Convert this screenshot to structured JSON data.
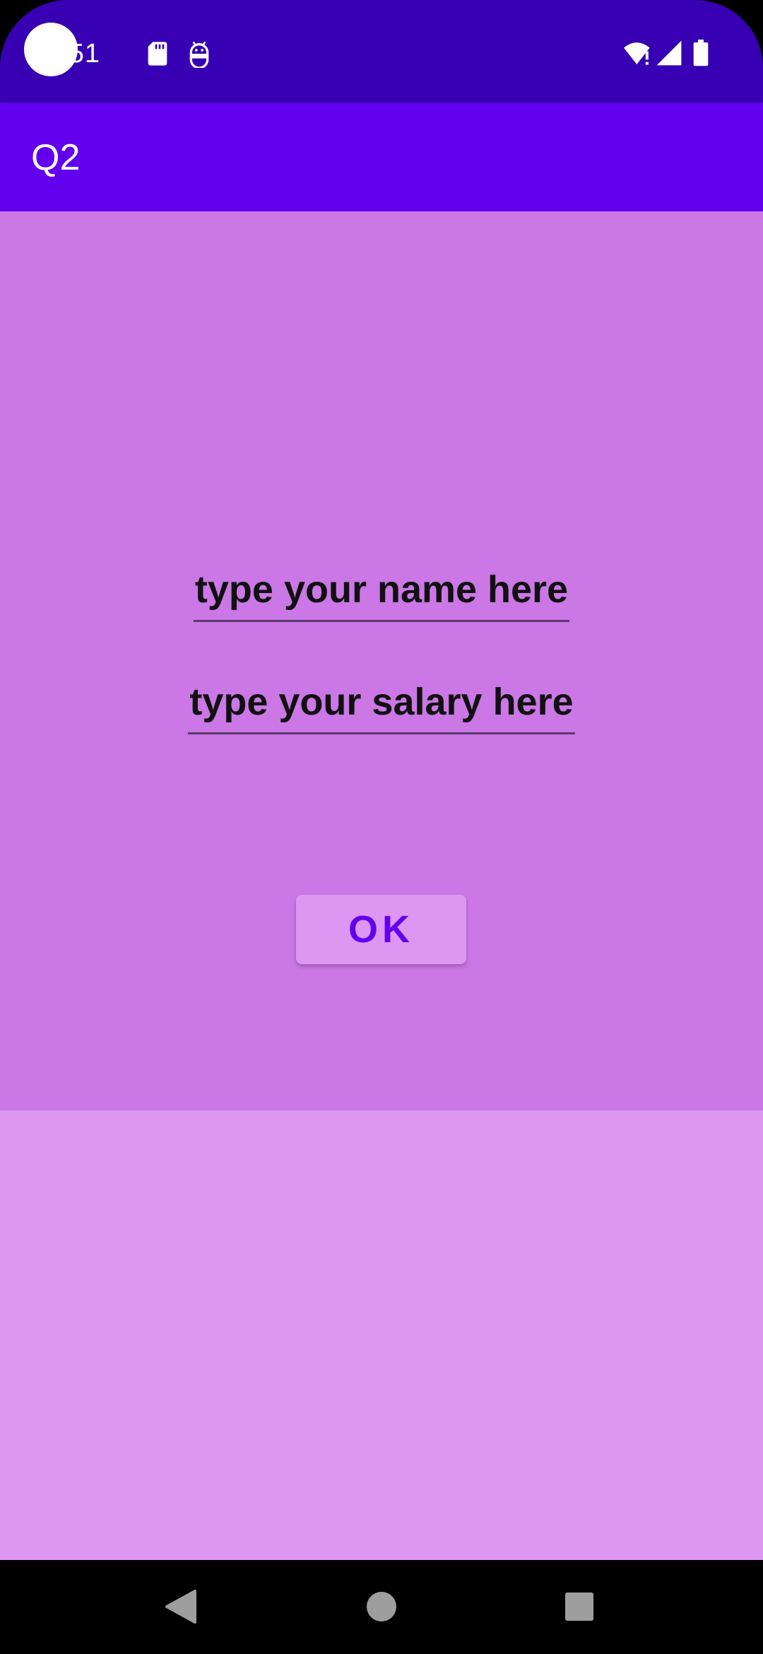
{
  "status_bar": {
    "time": "2:51",
    "icons": [
      "sd-card-icon",
      "android-debug-icon",
      "wifi-alert-icon",
      "cell-signal-icon",
      "battery-icon"
    ],
    "background": "#3700B3"
  },
  "app_bar": {
    "title": "Q2",
    "background": "#6200EE"
  },
  "form": {
    "name_placeholder": "type your name here",
    "salary_placeholder": "type your salary here",
    "ok_label": "OK",
    "background": "#CB77E6",
    "button_text_color": "#6200EE"
  },
  "lower_panel": {
    "background": "#DD97F2"
  },
  "nav_bar": {
    "icons": [
      "back-icon",
      "home-icon",
      "recents-icon"
    ]
  }
}
